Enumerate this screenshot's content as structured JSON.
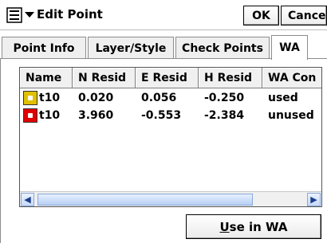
{
  "window": {
    "title": "Edit Point",
    "ok_label": "OK",
    "cancel_label": "Cancel"
  },
  "tabs": [
    {
      "label": "Point Info"
    },
    {
      "label": "Layer/Style"
    },
    {
      "label": "Check Points"
    },
    {
      "label": "WA",
      "active": true
    }
  ],
  "table": {
    "columns": [
      "Name",
      "N Resid",
      "E Resid",
      "H Resid",
      "WA Con"
    ],
    "rows": [
      {
        "name": "t10",
        "n_resid": "0.020",
        "e_resid": "0.056",
        "h_resid": "-0.250",
        "wa_con": "used",
        "icon": "point-used-icon",
        "color": "#e0c000"
      },
      {
        "name": "t10",
        "n_resid": "3.960",
        "e_resid": "-0.553",
        "h_resid": "-2.384",
        "wa_con": "unused",
        "icon": "point-unused-icon",
        "color": "#e00000"
      }
    ]
  },
  "use_button": {
    "label_first": "U",
    "label_rest": "se in WA"
  },
  "icons": {
    "menu": "menu-icon",
    "dropdown": "chevron-down-icon",
    "scroll_left": "scroll-left-icon",
    "scroll_right": "scroll-right-icon"
  }
}
